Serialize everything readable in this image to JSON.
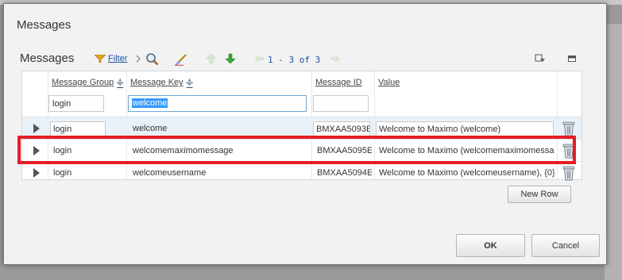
{
  "dialog": {
    "title": "Messages"
  },
  "section": {
    "title": "Messages",
    "filter_label": "Filter",
    "pager_text": "1 - 3 of 3"
  },
  "columns": [
    "Message Group",
    "Message Key",
    "Message ID",
    "Value"
  ],
  "filters": {
    "message_group": "login",
    "message_key": "welcome",
    "message_id": "",
    "value": ""
  },
  "rows": [
    {
      "group": "login",
      "key": "welcome",
      "id": "BMXAA5093E",
      "value": "Welcome to Maximo (welcome)",
      "selected": true
    },
    {
      "group": "login",
      "key": "welcomemaximomessage",
      "id": "BMXAA5095E",
      "value": "Welcome to Maximo (welcomemaximomessage)"
    },
    {
      "group": "login",
      "key": "welcomeusername",
      "id": "BMXAA5094E",
      "value": "Welcome to Maximo (welcomeusername), {0}"
    }
  ],
  "buttons": {
    "new_row": "New Row",
    "ok": "OK",
    "cancel": "Cancel"
  },
  "icons": [
    "filter-icon",
    "search-icon",
    "clear-filter-icon",
    "up-arrow-icon",
    "down-arrow-icon",
    "prev-page-icon",
    "next-page-icon",
    "download-icon",
    "collapse-icon",
    "row-expand-icon",
    "trash-icon"
  ],
  "colors": {
    "accent": "#1a4f9c",
    "highlight": "#e41e26",
    "selected_row": "#e9f1f8"
  }
}
